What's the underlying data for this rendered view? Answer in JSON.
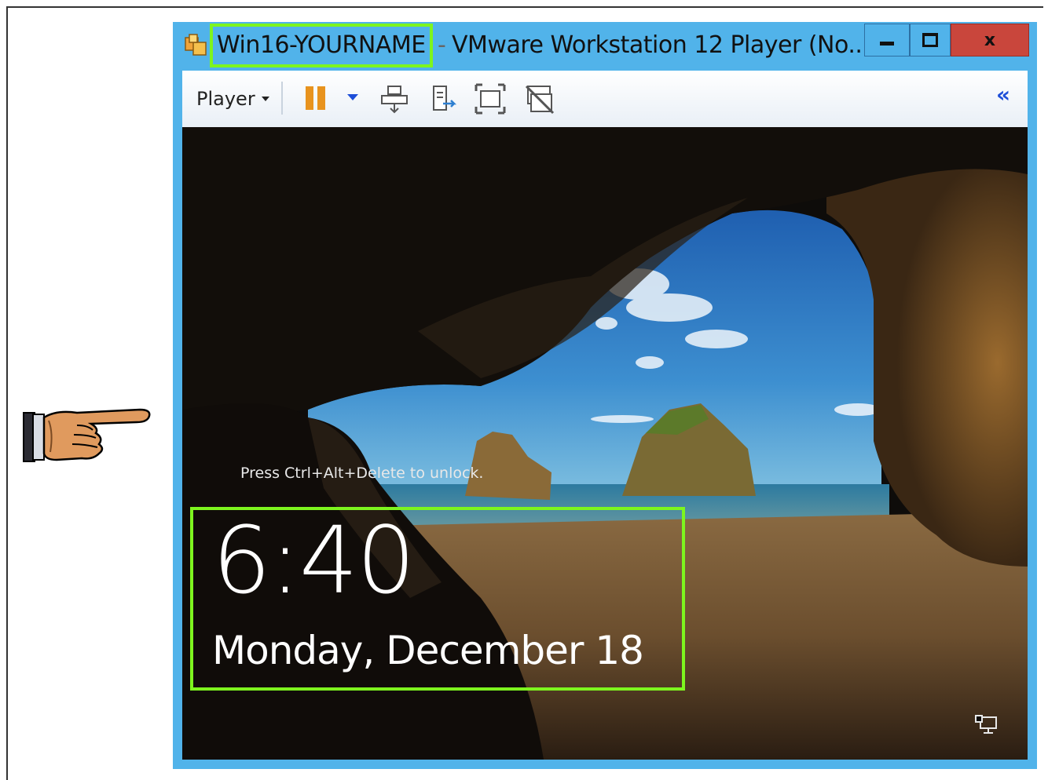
{
  "window": {
    "app_name": "Win16-YOURNAME",
    "title_suffix": "VMware Workstation 12 Player (No...",
    "controls": {
      "minimize_icon": "minimize-icon",
      "maximize_icon": "maximize-icon",
      "close_icon": "close-icon"
    }
  },
  "toolbar": {
    "player_label": "Player",
    "items": [
      "pause-icon",
      "dropdown-caret-icon",
      "send-ctrl-alt-del-icon",
      "removable-devices-icon",
      "full-screen-icon",
      "unity-icon"
    ],
    "collapse_icon": "double-chevron-left-icon"
  },
  "lockscreen": {
    "unlock_message": "Press Ctrl+Alt+Delete to unlock.",
    "time": "6:40",
    "date": "Monday, December 18",
    "network_icon": "network-icon"
  },
  "colors": {
    "window_frame": "#51b3ea",
    "highlight": "#7df51e",
    "close_button": "#c9463c",
    "pause_icon": "#e8931e"
  },
  "annotations": {
    "pointer_icon": "pointing-hand-icon"
  }
}
